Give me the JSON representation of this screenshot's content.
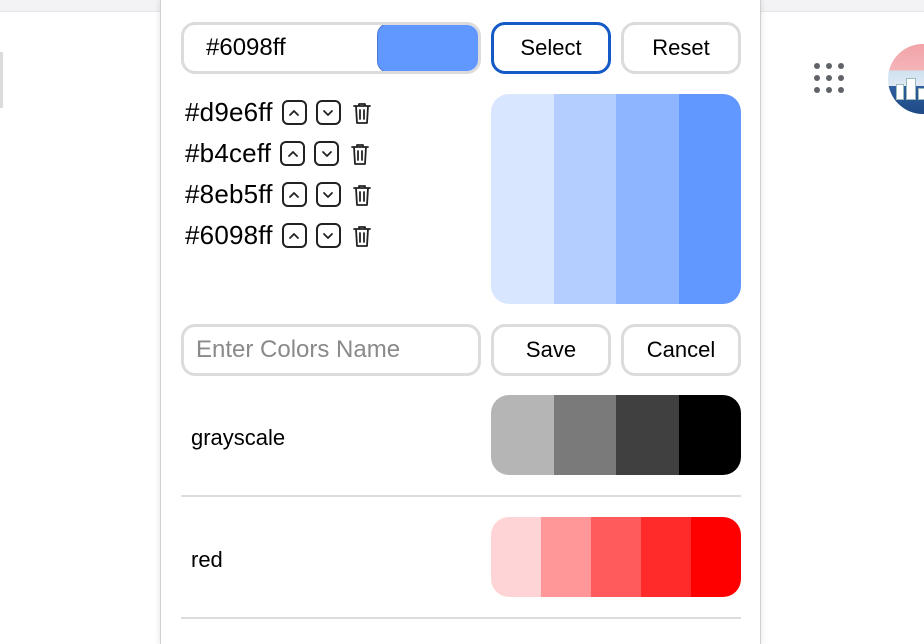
{
  "picker": {
    "hex_value": "#6098ff",
    "preview_color": "#6098ff",
    "select_label": "Select",
    "reset_label": "Reset"
  },
  "current_colors": [
    {
      "hex": "#d9e6ff"
    },
    {
      "hex": "#b4ceff"
    },
    {
      "hex": "#8eb5ff"
    },
    {
      "hex": "#6098ff"
    }
  ],
  "name_form": {
    "placeholder": "Enter Colors Name",
    "save_label": "Save",
    "cancel_label": "Cancel"
  },
  "saved_palettes": [
    {
      "name": "grayscale",
      "colors": [
        "#b5b5b5",
        "#7a7a7a",
        "#404040",
        "#000000"
      ]
    },
    {
      "name": "red",
      "colors": [
        "#ffd4d6",
        "#ff9698",
        "#ff5a5c",
        "#ff2a2a",
        "#ff0000"
      ]
    }
  ],
  "icons": {
    "move_up": "chevron-up-icon",
    "move_down": "chevron-down-icon",
    "delete": "trash-icon",
    "apps": "apps-grid-icon"
  }
}
